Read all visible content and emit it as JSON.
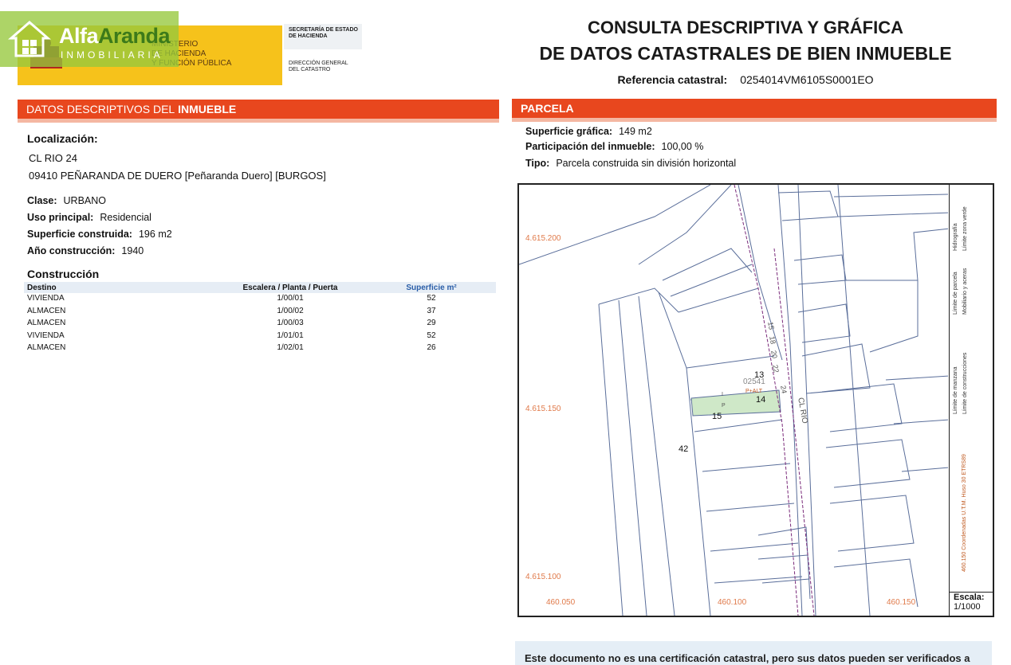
{
  "header": {
    "ministry_lines": [
      "MINISTERIO",
      "DE HACIENDA",
      "Y FUNCIÓN PÚBLICA"
    ],
    "agency_top": [
      "SECRETARÍA DE ESTADO",
      "DE HACIENDA"
    ],
    "agency_bottom": [
      "DIRECCIÓN GENERAL",
      "DEL CATASTRO"
    ],
    "title_line1": "CONSULTA DESCRIPTIVA Y GRÁFICA",
    "title_line2": "DE DATOS CATASTRALES DE BIEN INMUEBLE",
    "reference_label": "Referencia catastral:",
    "reference_value": "0254014VM6105S0001EO"
  },
  "watermark": {
    "brand_a": "Alfa",
    "brand_b": "Aranda",
    "sub": "INMOBILIARIA"
  },
  "descriptive": {
    "section_title": "DATOS DESCRIPTIVOS DEL",
    "section_title_bold": "INMUEBLE",
    "location_label": "Localización:",
    "address_line1": "CL RIO 24",
    "address_line2": "09410 PEÑARANDA DE DUERO [Peñaranda Duero] [BURGOS]",
    "clase_label": "Clase:",
    "clase_value": "URBANO",
    "uso_label": "Uso principal:",
    "uso_value": "Residencial",
    "superficie_label": "Superficie construida:",
    "superficie_value": "196 m2",
    "anio_label": "Año construcción:",
    "anio_value": "1940",
    "construccion_label": "Construcción",
    "table_headers": [
      "Destino",
      "Escalera / Planta / Puerta",
      "Superficie m²"
    ],
    "table_rows": [
      [
        "VIVIENDA",
        "1/00/01",
        "52"
      ],
      [
        "ALMACEN",
        "1/00/02",
        "37"
      ],
      [
        "ALMACEN",
        "1/00/03",
        "29"
      ],
      [
        "VIVIENDA",
        "1/01/01",
        "52"
      ],
      [
        "ALMACEN",
        "1/02/01",
        "26"
      ]
    ]
  },
  "parcela": {
    "section_title": "PARCELA",
    "sup_label": "Superficie gráfica:",
    "sup_value": "149 m2",
    "part_label": "Participación del inmueble:",
    "part_value": "100,00 %",
    "tipo_label": "Tipo:",
    "tipo_value": "Parcela construida sin división horizontal"
  },
  "map": {
    "y_labels": [
      "4.615.200",
      "4.615.150",
      "4.615.100"
    ],
    "x_labels": [
      "460.050",
      "460.100",
      "460.150"
    ],
    "parcel_ref": "02541",
    "street": "CL RIO",
    "plot_numbers": [
      "13",
      "14",
      "15",
      "42"
    ],
    "street_numbers": [
      "15",
      "18",
      "20",
      "22",
      "24"
    ],
    "legend_items": [
      "Límite de manzana",
      "Límite de parcela",
      "Límite de construcciones",
      "Mobiliario y aceras",
      "Límite zona verde",
      "Hidrografía"
    ],
    "coord_note": "460.150 Coordenadas U.T.M. Huso 30 ETRS89",
    "scale_label": "Escala:",
    "scale_value": "1/1000",
    "parcel_labels": [
      "P+ALT",
      "P",
      "I"
    ]
  },
  "footer": {
    "note": "Este documento no es una certificación catastral, pero sus datos pueden ser verificados a"
  },
  "colors": {
    "section": "#e8471e",
    "gov_yellow": "#f6c21b",
    "watermark": "#96c83c"
  }
}
